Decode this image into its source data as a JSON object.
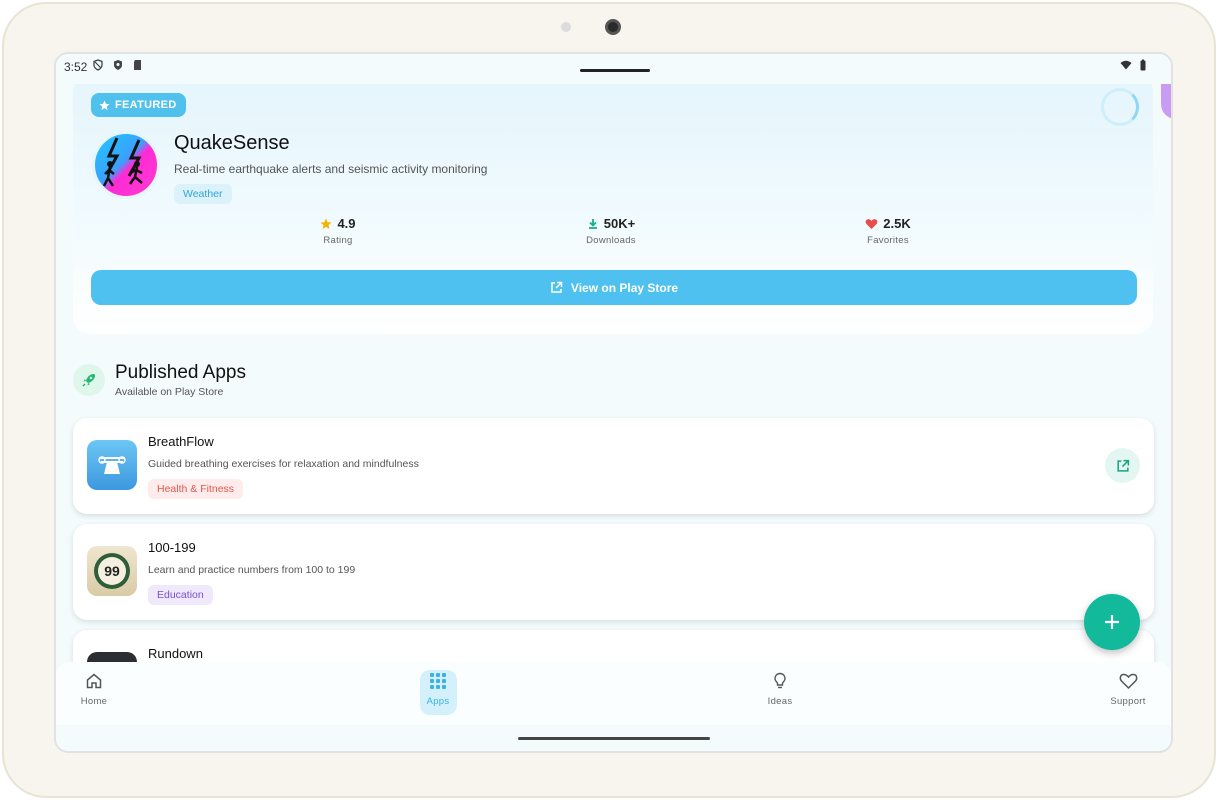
{
  "status_bar": {
    "time": "3:52"
  },
  "featured": {
    "badge": "FEATURED",
    "app_name": "QuakeSense",
    "description": "Real-time earthquake alerts and seismic activity monitoring",
    "category": "Weather",
    "stats": [
      {
        "value": "4.9",
        "label": "Rating",
        "icon": "star-icon",
        "color": "#f5b400"
      },
      {
        "value": "50K+",
        "label": "Downloads",
        "icon": "download-icon",
        "color": "#14b08a"
      },
      {
        "value": "2.5K",
        "label": "Favorites",
        "icon": "heart-icon",
        "color": "#e84c4c"
      }
    ],
    "play_button": "View on Play Store"
  },
  "published": {
    "title": "Published Apps",
    "subtitle": "Available on Play Store",
    "apps": [
      {
        "name": "BreathFlow",
        "description": "Guided breathing exercises for relaxation and mindfulness",
        "category": "Health & Fitness"
      },
      {
        "name": "100-199",
        "description": "Learn and practice numbers from 100 to 199",
        "category": "Education",
        "icon_text": "99"
      },
      {
        "name": "Rundown"
      }
    ]
  },
  "nav": {
    "items": [
      {
        "label": "Home"
      },
      {
        "label": "Apps"
      },
      {
        "label": "Ideas"
      },
      {
        "label": "Support"
      }
    ],
    "active": "Apps"
  },
  "colors": {
    "accent": "#4fc1f0",
    "fab": "#12b99a",
    "health_chip_text": "#e2574c",
    "education_chip_text": "#7b4fcf"
  }
}
